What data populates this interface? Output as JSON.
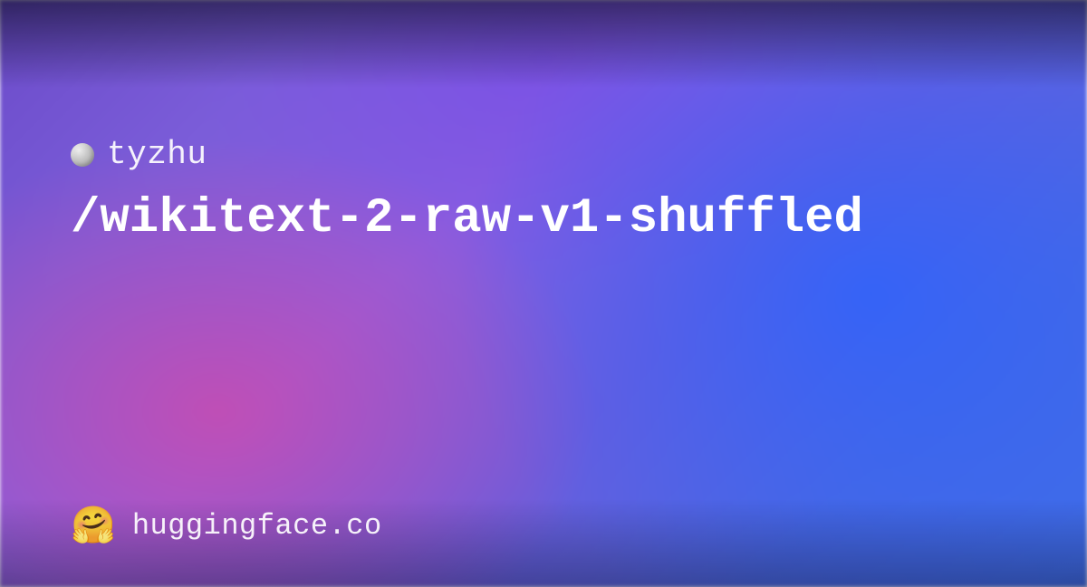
{
  "owner": {
    "name": "tyzhu"
  },
  "repo": {
    "path": "/wikitext-2-raw-v1-shuffled"
  },
  "footer": {
    "emoji": "🤗",
    "domain": "huggingface.co"
  }
}
